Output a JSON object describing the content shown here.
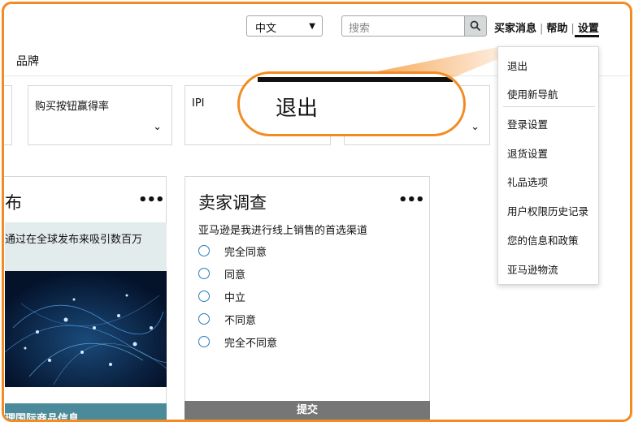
{
  "header": {
    "language": "中文",
    "search_placeholder": "搜索",
    "links": [
      "买家消息",
      "帮助",
      "设置"
    ]
  },
  "nav": {
    "brand": "品牌"
  },
  "filters": [
    {
      "label": ""
    },
    {
      "label": "购买按钮赢得率"
    },
    {
      "label": "IPI"
    },
    {
      "label": ""
    }
  ],
  "left_card": {
    "title_fragment": "布",
    "body_text": "通过在全球发布来吸引数百万",
    "footer_text": "理国际商品信息"
  },
  "survey_card": {
    "title": "卖家调查",
    "question": "亚马逊是我进行线上销售的首选渠道",
    "options": [
      "完全同意",
      "同意",
      "中立",
      "不同意",
      "完全不同意"
    ],
    "submit_label": "提交"
  },
  "settings_menu": {
    "items": [
      "退出",
      "使用新导航",
      "登录设置",
      "退货设置",
      "礼品选项",
      "用户权限历史记录",
      "您的信息和政策",
      "亚马逊物流"
    ]
  },
  "callout": {
    "text": "退出"
  },
  "colors": {
    "accent": "#f28b22",
    "radio": "#2a7db8",
    "submit_bg": "#767676"
  },
  "icons": [
    "chevron-down-icon",
    "search-icon",
    "more-options-icon",
    "radio-icon"
  ]
}
